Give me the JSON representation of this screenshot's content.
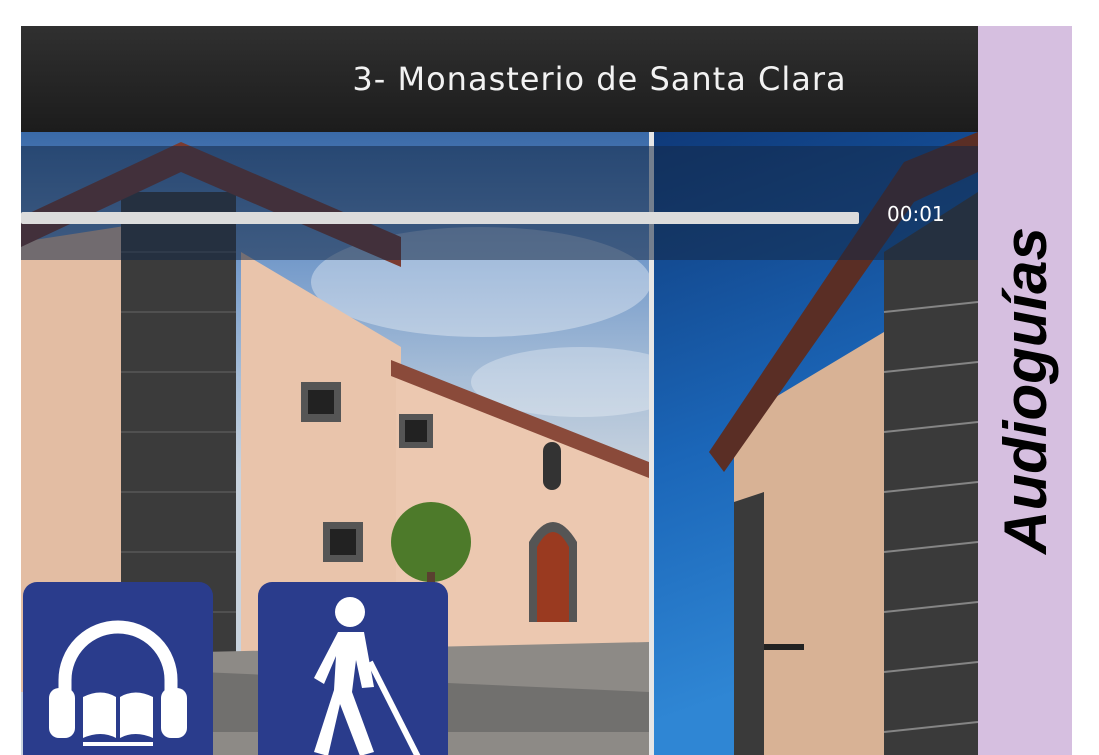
{
  "header": {
    "title": "3- Monasterio de Santa Clara"
  },
  "player": {
    "time": "00:01",
    "progress": 0.0
  },
  "sidebar": {
    "label": "Audioguías"
  },
  "buttons": [
    {
      "icon": "headphones-book-icon"
    },
    {
      "icon": "blind-person-cane-icon"
    }
  ],
  "colors": {
    "accent": "#2a3c8c",
    "sidebar": "#d6bfe0",
    "header": "#232323"
  }
}
